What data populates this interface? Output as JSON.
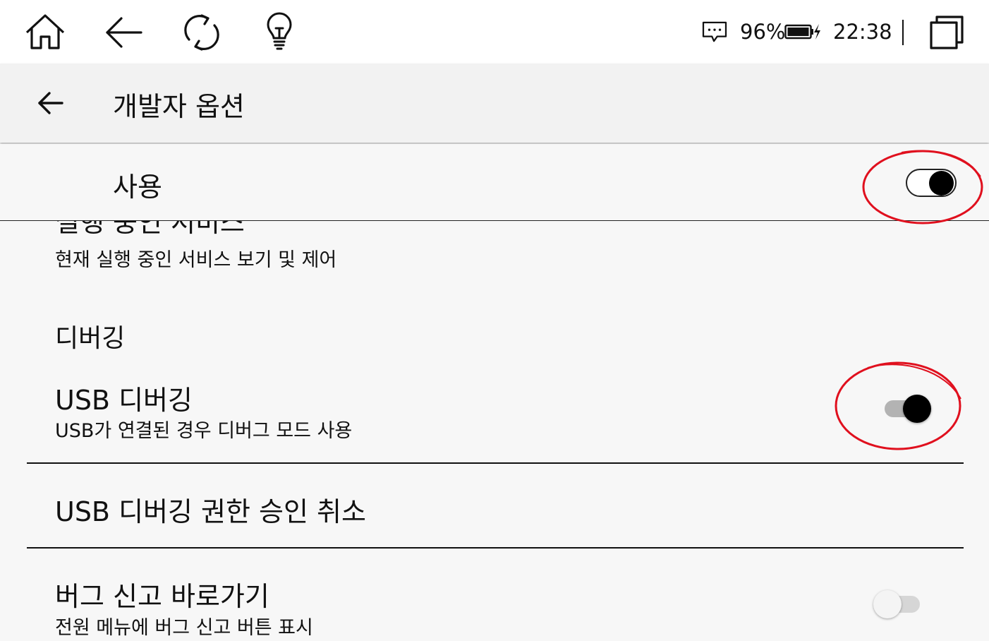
{
  "status_bar": {
    "icons": [
      "home-icon",
      "back-arrow-icon",
      "refresh-icon",
      "lightbulb-icon"
    ],
    "message_icon": "message-dots-icon",
    "battery_percent": "96%",
    "battery_level": 0.96,
    "charging": true,
    "time": "22:38",
    "recent_apps_icon": "recent-apps-icon"
  },
  "app_bar": {
    "back_icon": "arrow-back-icon",
    "title": "개발자 옵션"
  },
  "master_switch": {
    "label": "사용",
    "enabled": true
  },
  "items": {
    "running_services": {
      "title": "실행 중인 서비스",
      "subtitle": "현재 실행 중인 서비스 보기 및 제어"
    },
    "debugging_header": "디버깅",
    "usb_debugging": {
      "title": "USB 디버깅",
      "subtitle": "USB가 연결된 경우 디버그 모드 사용",
      "enabled": true
    },
    "revoke_usb_auth": {
      "title": "USB 디버깅 권한 승인 취소"
    },
    "bug_report_shortcut": {
      "title": "버그 신고 바로가기",
      "subtitle": "전원 메뉴에 버그 신고 버튼 표시",
      "enabled": false
    }
  },
  "colors": {
    "annotation": "#e0101e",
    "background": "#f7f7f7",
    "app_bar": "#f2f2f2",
    "status_bar": "#ffffff"
  }
}
